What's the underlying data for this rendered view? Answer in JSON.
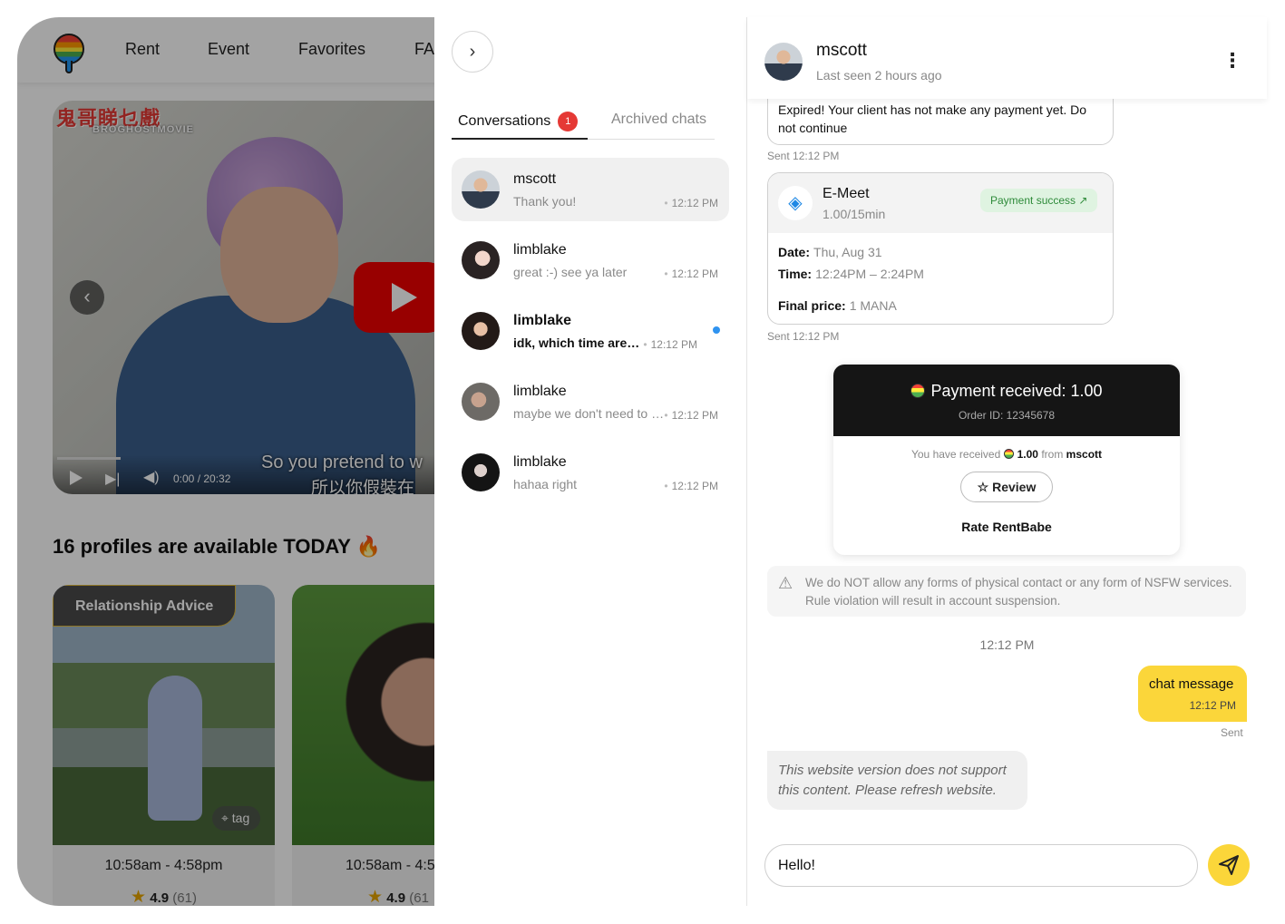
{
  "background_app": {
    "nav": {
      "links": [
        "Rent",
        "Event",
        "Favorites",
        "FA"
      ]
    },
    "video": {
      "brand": "鬼哥睇乜戲",
      "brand_sub": "BROGHOSTMOVIE",
      "time": "0:00 / 20:32",
      "subtitle_en": "So you pretend to w",
      "subtitle_zh": "所以你假裝在"
    },
    "profiles_heading": "16 profiles are available TODAY 🔥",
    "cards": [
      {
        "badge": "Relationship Advice",
        "tag": "tag",
        "time": "10:58am - 4:58pm",
        "score": "4.9",
        "count": "(61)"
      },
      {
        "time": "10:58am - 4:5",
        "score": "4.9",
        "count": "(61"
      }
    ]
  },
  "conversations": {
    "tabs": {
      "conversations_label": "Conversations",
      "conversations_badge": "1",
      "archived_label": "Archived chats"
    },
    "items": [
      {
        "name": "mscott",
        "preview": "Thank you!",
        "time": "12:12 PM",
        "unread": false,
        "active": true
      },
      {
        "name": "limblake",
        "preview": "great :-) see ya later",
        "time": "12:12 PM",
        "unread": false,
        "active": false
      },
      {
        "name": "limblake",
        "preview": "idk, which time are you free?",
        "time": "12:12 PM",
        "unread": true,
        "active": false
      },
      {
        "name": "limblake",
        "preview": "maybe we don't need to meet",
        "time": "12:12 PM",
        "unread": false,
        "active": false
      },
      {
        "name": "limblake",
        "preview": "hahaa right",
        "time": "12:12 PM",
        "unread": false,
        "active": false
      }
    ]
  },
  "chat": {
    "header": {
      "name": "mscott",
      "last_seen": "Last seen 2 hours ago"
    },
    "expired_message": "Expired! Your client has not make any payment yet. Do not continue",
    "expired_status": "Sent 12:12 PM",
    "emeet": {
      "title": "E-Meet",
      "price": "1.00/15min",
      "payment_status": "Payment success",
      "date_label": "Date:",
      "date_value": "Thu, Aug 31",
      "time_label": "Time:",
      "time_value": "12:24PM – 2:24PM",
      "final_label": "Final price:",
      "final_value": "1 MANA",
      "status": "Sent 12:12 PM"
    },
    "receipt": {
      "title": "Payment received: 1.00",
      "order_id": "Order ID: 12345678",
      "received_prefix": "You have received",
      "received_amount": "1.00",
      "received_from": "from",
      "received_user": "mscott",
      "review_label": "Review",
      "rate_label": "Rate RentBabe"
    },
    "rule_notice": "We do NOT allow any forms of physical contact or any form of NSFW services. Rule violation will result in account suspension.",
    "timestamp": "12:12 PM",
    "outgoing": {
      "text": "chat message",
      "time": "12:12 PM",
      "status": "Sent"
    },
    "unsupported": "This website version does not support this content. Please refresh website.",
    "input": {
      "value": "Hello!"
    }
  },
  "colors": {
    "accent_yellow": "#fbd63a",
    "badge_red": "#e53935",
    "unread_blue": "#2f93f0",
    "success_green": "#2e8b3a"
  }
}
